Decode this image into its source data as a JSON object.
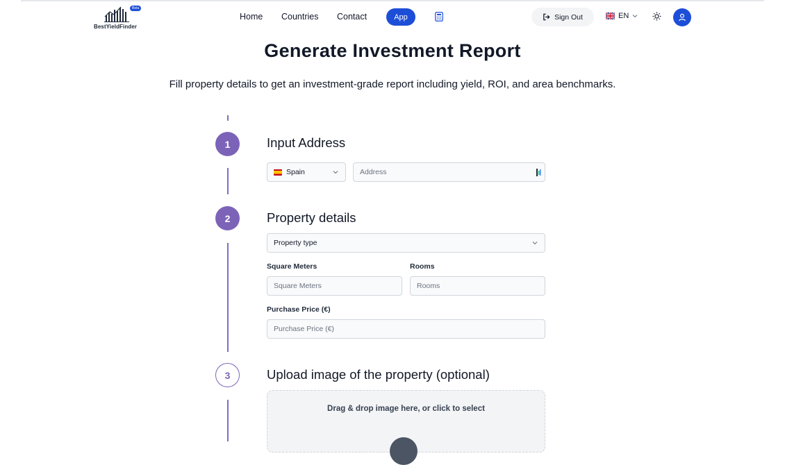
{
  "header": {
    "logo": {
      "name": "BestYieldFinder",
      "badge": "Beta"
    },
    "nav": [
      {
        "label": "Home"
      },
      {
        "label": "Countries"
      },
      {
        "label": "Contact"
      },
      {
        "label": "App"
      }
    ],
    "calculator_icon": "calculator-icon",
    "sign_out_label": "Sign Out",
    "language": {
      "code": "EN",
      "flag_icon": "uk-flag-icon"
    },
    "theme_icon": "sun-icon",
    "avatar_icon": "user-icon"
  },
  "page": {
    "title": "Generate Investment Report",
    "subtitle": "Fill property details to get an investment-grade report including yield, ROI, and area benchmarks."
  },
  "steps": [
    {
      "number": "1",
      "title": "Input Address",
      "country_select": {
        "value": "Spain",
        "flag_icon": "spain-flag-icon"
      },
      "address_input": {
        "placeholder": "Address"
      }
    },
    {
      "number": "2",
      "title": "Property details",
      "property_type_select": {
        "value": "Property type"
      },
      "square_meters": {
        "label": "Square Meters",
        "placeholder": "Square Meters"
      },
      "rooms": {
        "label": "Rooms",
        "placeholder": "Rooms"
      },
      "purchase_price": {
        "label": "Purchase Price (€)",
        "placeholder": "Purchase Price (€)"
      }
    },
    {
      "number": "3",
      "title": "Upload image of the property (optional)",
      "dropzone_text": "Drag & drop image here, or click to select"
    }
  ],
  "colors": {
    "brand_blue": "#1d4ed8",
    "step_purple": "#7c63b8",
    "line_purple": "#7c6fc4"
  }
}
